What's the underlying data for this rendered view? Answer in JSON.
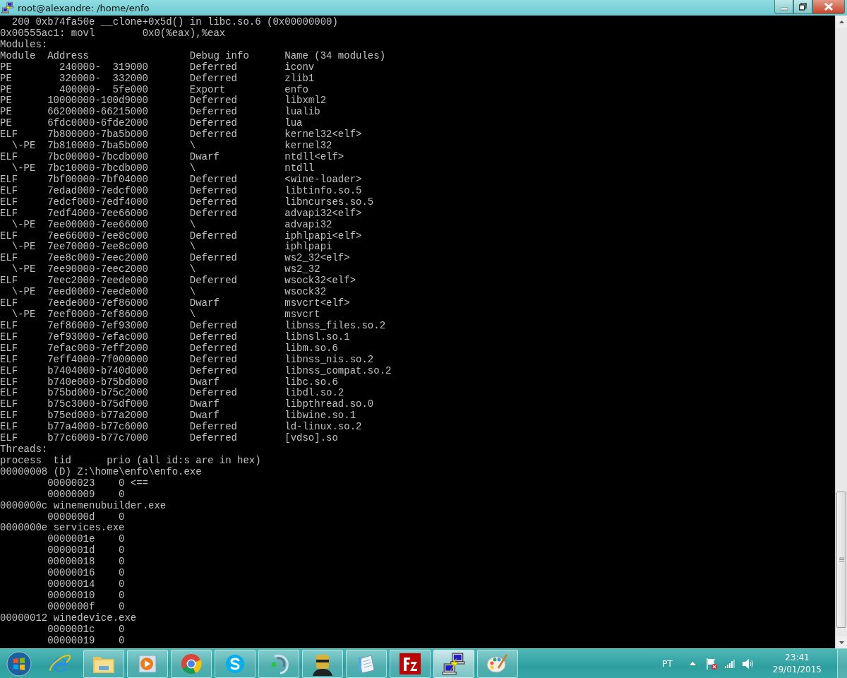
{
  "window": {
    "title": "root@alexandre: /home/enfo",
    "controls": [
      {
        "kind": "minimize"
      },
      {
        "kind": "restore"
      },
      {
        "kind": "close"
      }
    ]
  },
  "terminal": {
    "backtrace_line": "200 0xb74fa50e __clone+0x5d() in libc.so.6 (0x00000000)",
    "instruction_line": "0x00555ac1: movl        0x0(%eax),%eax",
    "modules": {
      "heading": "Modules:",
      "columns": [
        "Module",
        "Address",
        "Debug info",
        "Name (34 modules)"
      ],
      "rows": [
        {
          "type": "PE",
          "address": "240000-  319000",
          "debug": "Deferred",
          "name": "iconv"
        },
        {
          "type": "PE",
          "address": "320000-  332000",
          "debug": "Deferred",
          "name": "zlib1"
        },
        {
          "type": "PE",
          "address": "400000-  5fe000",
          "debug": "Export",
          "name": "enfo"
        },
        {
          "type": "PE",
          "address": "10000000-100d9000",
          "debug": "Deferred",
          "name": "libxml2"
        },
        {
          "type": "PE",
          "address": "66200000-66215000",
          "debug": "Deferred",
          "name": "lualib"
        },
        {
          "type": "PE",
          "address": "6fdc0000-6fde2000",
          "debug": "Deferred",
          "name": "lua"
        },
        {
          "type": "ELF",
          "address": "7b800000-7ba5b000",
          "debug": "Deferred",
          "name": "kernel32<elf>",
          "children": [
            {
              "type": "\\-PE",
              "address": "7b810000-7ba5b000",
              "debug": "\\",
              "name": "kernel32"
            }
          ]
        },
        {
          "type": "ELF",
          "address": "7bc00000-7bcdb000",
          "debug": "Dwarf",
          "name": "ntdll<elf>",
          "children": [
            {
              "type": "\\-PE",
              "address": "7bc10000-7bcdb000",
              "debug": "\\",
              "name": "ntdll"
            }
          ]
        },
        {
          "type": "ELF",
          "address": "7bf00000-7bf04000",
          "debug": "Deferred",
          "name": "<wine-loader>"
        },
        {
          "type": "ELF",
          "address": "7edad000-7edcf000",
          "debug": "Deferred",
          "name": "libtinfo.so.5"
        },
        {
          "type": "ELF",
          "address": "7edcf000-7edf4000",
          "debug": "Deferred",
          "name": "libncurses.so.5"
        },
        {
          "type": "ELF",
          "address": "7edf4000-7ee66000",
          "debug": "Deferred",
          "name": "advapi32<elf>",
          "children": [
            {
              "type": "\\-PE",
              "address": "7ee00000-7ee66000",
              "debug": "\\",
              "name": "advapi32"
            }
          ]
        },
        {
          "type": "ELF",
          "address": "7ee66000-7ee8c000",
          "debug": "Deferred",
          "name": "iphlpapi<elf>",
          "children": [
            {
              "type": "\\-PE",
              "address": "7ee70000-7ee8c000",
              "debug": "\\",
              "name": "iphlpapi"
            }
          ]
        },
        {
          "type": "ELF",
          "address": "7ee8c000-7eec2000",
          "debug": "Deferred",
          "name": "ws2_32<elf>",
          "children": [
            {
              "type": "\\-PE",
              "address": "7ee90000-7eec2000",
              "debug": "\\",
              "name": "ws2_32"
            }
          ]
        },
        {
          "type": "ELF",
          "address": "7eec2000-7eede000",
          "debug": "Deferred",
          "name": "wsock32<elf>",
          "children": [
            {
              "type": "\\-PE",
              "address": "7eed0000-7eede000",
              "debug": "\\",
              "name": "wsock32"
            }
          ]
        },
        {
          "type": "ELF",
          "address": "7eede000-7ef86000",
          "debug": "Dwarf",
          "name": "msvcrt<elf>",
          "children": [
            {
              "type": "\\-PE",
              "address": "7eef0000-7ef86000",
              "debug": "\\",
              "name": "msvcrt"
            }
          ]
        },
        {
          "type": "ELF",
          "address": "7ef86000-7ef93000",
          "debug": "Deferred",
          "name": "libnss_files.so.2"
        },
        {
          "type": "ELF",
          "address": "7ef93000-7efac000",
          "debug": "Deferred",
          "name": "libnsl.so.1"
        },
        {
          "type": "ELF",
          "address": "7efac000-7eff2000",
          "debug": "Deferred",
          "name": "libm.so.6"
        },
        {
          "type": "ELF",
          "address": "7eff4000-7f000000",
          "debug": "Deferred",
          "name": "libnss_nis.so.2"
        },
        {
          "type": "ELF",
          "address": "b7404000-b740d000",
          "debug": "Deferred",
          "name": "libnss_compat.so.2"
        },
        {
          "type": "ELF",
          "address": "b740e000-b75bd000",
          "debug": "Dwarf",
          "name": "libc.so.6"
        },
        {
          "type": "ELF",
          "address": "b75bd000-b75c2000",
          "debug": "Deferred",
          "name": "libdl.so.2"
        },
        {
          "type": "ELF",
          "address": "b75c3000-b75df000",
          "debug": "Dwarf",
          "name": "libpthread.so.0"
        },
        {
          "type": "ELF",
          "address": "b75ed000-b77a2000",
          "debug": "Dwarf",
          "name": "libwine.so.1"
        },
        {
          "type": "ELF",
          "address": "b77a4000-b77c6000",
          "debug": "Deferred",
          "name": "ld-linux.so.2"
        },
        {
          "type": "ELF",
          "address": "b77c6000-b77c7000",
          "debug": "Deferred",
          "name": "[vdso].so"
        }
      ]
    },
    "threads": {
      "heading": "Threads:",
      "columns": [
        "process",
        "tid",
        "prio (all id:s are in hex)"
      ],
      "processes": [
        {
          "id": "00000008",
          "name": "(D) Z:\\home\\enfo\\enfo.exe",
          "children": [
            {
              "tid": "00000023",
              "prio": "0",
              "marker": "<=="
            },
            {
              "tid": "00000009",
              "prio": "0"
            }
          ]
        },
        {
          "id": "0000000c",
          "name": "winemenubuilder.exe",
          "children": [
            {
              "tid": "0000000d",
              "prio": "0"
            }
          ]
        },
        {
          "id": "0000000e",
          "name": "services.exe",
          "children": [
            {
              "tid": "0000001e",
              "prio": "0"
            },
            {
              "tid": "0000001d",
              "prio": "0"
            },
            {
              "tid": "00000018",
              "prio": "0"
            },
            {
              "tid": "00000016",
              "prio": "0"
            },
            {
              "tid": "00000014",
              "prio": "0"
            },
            {
              "tid": "00000010",
              "prio": "0"
            },
            {
              "tid": "0000000f",
              "prio": "0"
            }
          ]
        },
        {
          "id": "00000012",
          "name": "winedevice.exe",
          "children": [
            {
              "tid": "0000001c",
              "prio": "0"
            },
            {
              "tid": "00000019",
              "prio": "0"
            }
          ]
        }
      ]
    }
  },
  "taskbar": {
    "items": [
      {
        "kind": "ie",
        "running": false,
        "selected": false
      },
      {
        "kind": "folder",
        "running": true,
        "selected": false
      },
      {
        "kind": "media",
        "running": true,
        "selected": false
      },
      {
        "kind": "chrome",
        "running": true,
        "selected": false
      },
      {
        "kind": "skype",
        "running": true,
        "selected": false
      },
      {
        "kind": "teamspeak",
        "running": true,
        "selected": false
      },
      {
        "kind": "avatar",
        "running": true,
        "selected": false
      },
      {
        "kind": "notepad",
        "running": true,
        "selected": false
      },
      {
        "kind": "filezilla",
        "running": true,
        "selected": false
      },
      {
        "kind": "putty",
        "running": true,
        "selected": true
      },
      {
        "kind": "paint",
        "running": true,
        "selected": false
      }
    ],
    "tray": {
      "language": "PT",
      "time": "23:41",
      "date": "29/01/2015"
    }
  }
}
